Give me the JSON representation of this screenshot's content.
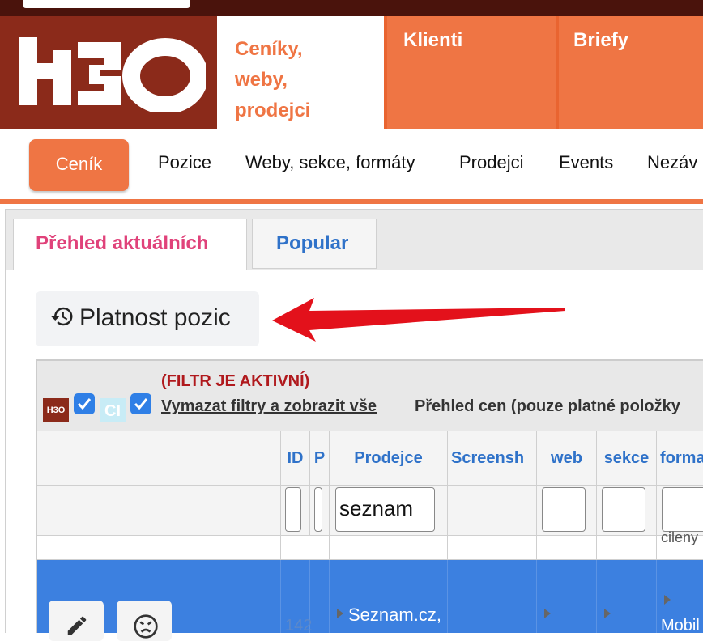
{
  "header": {
    "tabs": [
      {
        "label_lines": [
          "Ceníky,",
          "weby,",
          "prodejci"
        ]
      },
      {
        "label": "Klienti"
      },
      {
        "label": "Briefy"
      }
    ],
    "logo_text": "H3O"
  },
  "subnav": {
    "active": "Ceník",
    "items": [
      "Pozice",
      "Weby, sekce, formáty",
      "Prodejci",
      "Events",
      "Nezáv"
    ]
  },
  "page_tabs": [
    "Přehled aktuálních",
    "Popular"
  ],
  "platnost_button": "Platnost pozic",
  "grid": {
    "filter_status": "(FILTR JE AKTIVNÍ)",
    "clear_filters": "Vymazat filtry a zobrazit vše",
    "overview": "Přehled cen (pouze platné položky",
    "mini_logo": "H3O",
    "mini_ci": "CI",
    "columns": [
      "ID",
      "P",
      "Prodejce",
      "Screensh",
      "web",
      "sekce",
      "forma"
    ],
    "filter_value": "seznam",
    "clipped_text": "cileny",
    "row": {
      "id": "142",
      "prodejce": "Seznam.cz,",
      "format": "Mobil"
    }
  },
  "colors": {
    "accent": "#ef7544",
    "brand_dark": "#8b2a1a",
    "link_blue": "#2f72c9",
    "active_tab": "#e0427a",
    "warning_red": "#b0191d",
    "selection": "#3c80e0"
  }
}
